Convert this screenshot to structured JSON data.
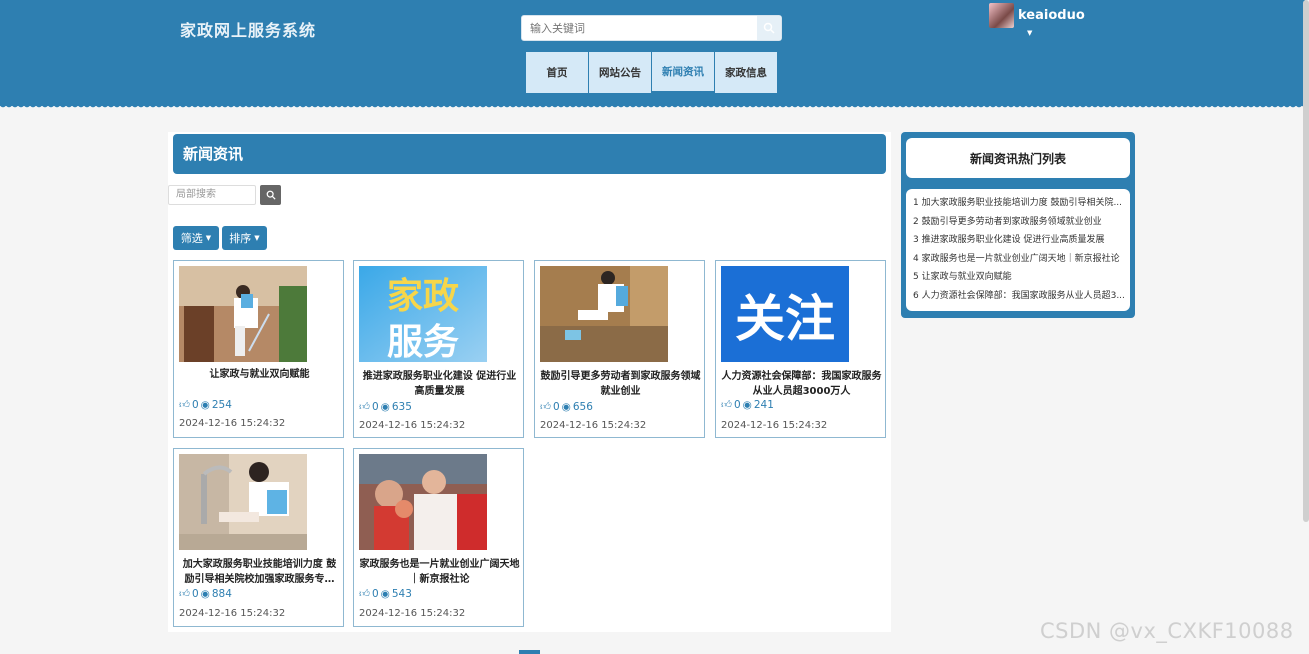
{
  "header": {
    "site_title": "家政网上服务系统",
    "search_placeholder": "输入关键词",
    "nav": [
      "首页",
      "网站公告",
      "新闻资讯",
      "家政信息"
    ],
    "active_nav": "新闻资讯",
    "username": "keaioduo"
  },
  "main": {
    "section_title": "新闻资讯",
    "local_search_placeholder": "局部搜索",
    "filter_label": "筛选",
    "sort_label": "排序",
    "cards": [
      {
        "title": "让家政与就业双向赋能",
        "likes": "0",
        "views": "254",
        "date": "2024-12-16 15:24:32"
      },
      {
        "title": "推进家政服务职业化建设 促进行业高质量发展",
        "likes": "0",
        "views": "635",
        "date": "2024-12-16 15:24:32",
        "thumb_text": "家政服务"
      },
      {
        "title": "鼓励引导更多劳动者到家政服务领域就业创业",
        "likes": "0",
        "views": "656",
        "date": "2024-12-16 15:24:32"
      },
      {
        "title": "人力资源社会保障部：我国家政服务从业人员超3000万人",
        "likes": "0",
        "views": "241",
        "date": "2024-12-16 15:24:32",
        "thumb_text": "关注"
      },
      {
        "title": "加大家政服务职业技能培训力度 鼓励引导相关院校加强家政服务专…",
        "likes": "0",
        "views": "884",
        "date": "2024-12-16 15:24:32"
      },
      {
        "title": "家政服务也是一片就业创业广阔天地｜新京报社论",
        "likes": "0",
        "views": "543",
        "date": "2024-12-16 15:24:32"
      }
    ]
  },
  "sidebar": {
    "title": "新闻资讯热门列表",
    "items": [
      "1 加大家政服务职业技能培训力度 鼓励引导相关院...",
      "2 鼓励引导更多劳动者到家政服务领域就业创业",
      "3 推进家政服务职业化建设 促进行业高质量发展",
      "4 家政服务也是一片就业创业广阔天地｜新京报社论",
      "5 让家政与就业双向赋能",
      "6 人力资源社会保障部：我国家政服务从业人员超3..."
    ]
  },
  "watermark": "CSDN @vx_CXKF10088",
  "colors": {
    "primary": "#2e7fb1",
    "nav_bg": "#d5e9f7"
  }
}
